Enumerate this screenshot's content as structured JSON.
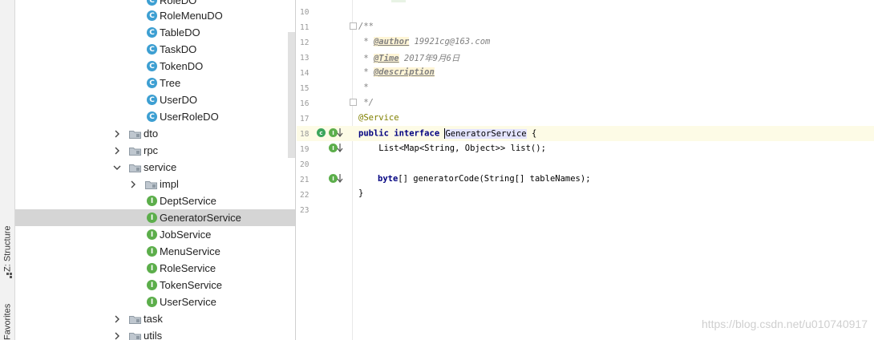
{
  "tool_strip": {
    "structure_label": "Z: Structure",
    "favorites_label": "Favorites"
  },
  "tree": {
    "rows": [
      {
        "label": "RoleDO",
        "type": "class"
      },
      {
        "label": "RoleMenuDO",
        "type": "class"
      },
      {
        "label": "TableDO",
        "type": "class"
      },
      {
        "label": "TaskDO",
        "type": "class"
      },
      {
        "label": "TokenDO",
        "type": "class"
      },
      {
        "label": "Tree",
        "type": "class"
      },
      {
        "label": "UserDO",
        "type": "class"
      },
      {
        "label": "UserRoleDO",
        "type": "class"
      },
      {
        "label": "dto",
        "type": "folder",
        "expanded": false
      },
      {
        "label": "rpc",
        "type": "folder",
        "expanded": false
      },
      {
        "label": "service",
        "type": "folder",
        "expanded": true
      },
      {
        "label": "impl",
        "type": "folder",
        "expanded": false
      },
      {
        "label": "DeptService",
        "type": "interface"
      },
      {
        "label": "GeneratorService",
        "type": "interface",
        "selected": true
      },
      {
        "label": "JobService",
        "type": "interface"
      },
      {
        "label": "MenuService",
        "type": "interface"
      },
      {
        "label": "RoleService",
        "type": "interface"
      },
      {
        "label": "TokenService",
        "type": "interface"
      },
      {
        "label": "UserService",
        "type": "interface"
      },
      {
        "label": "task",
        "type": "folder",
        "expanded": false
      },
      {
        "label": "utils",
        "type": "folder",
        "expanded": false
      }
    ],
    "class_glyph": "C",
    "interface_glyph": "I"
  },
  "editor": {
    "line_numbers": [
      "10",
      "11",
      "12",
      "13",
      "14",
      "15",
      "16",
      "17",
      "18",
      "19",
      "20",
      "21",
      "22",
      "23"
    ],
    "l11": "/**",
    "l12_star": " * ",
    "l12_tag": "@author",
    "l12_text": " 19921cg@163.com",
    "l13_star": " * ",
    "l13_tag": "@Time",
    "l13_text": " 2017年9月6日",
    "l14_star": " * ",
    "l14_tag": "@description",
    "l15": " *",
    "l16": " */",
    "l17": "@Service",
    "l18_kw": "public interface",
    "l18_name": "GeneratorService",
    "l18_tail": " {",
    "l19": "    List<Map<String, Object>> list();",
    "l21_kw": "byte",
    "l21_tail": "[] generatorCode(String[] tableNames);",
    "l22": "}"
  },
  "colors": {
    "class_icon": "#3d9fd2",
    "interface_icon": "#5cae4b",
    "selected_row": "#d5d5d5",
    "current_line": "#fdfbe6",
    "keyword": "#000080",
    "annotation": "#808000",
    "comment": "#808080"
  },
  "icons": {
    "expand": "chevron-right-icon",
    "collapse": "chevron-down-icon",
    "folder": "folder-icon",
    "implemented": "implemented-icon",
    "override_arrow": "down-arrow-icon"
  },
  "watermark": "https://blog.csdn.net/u010740917"
}
